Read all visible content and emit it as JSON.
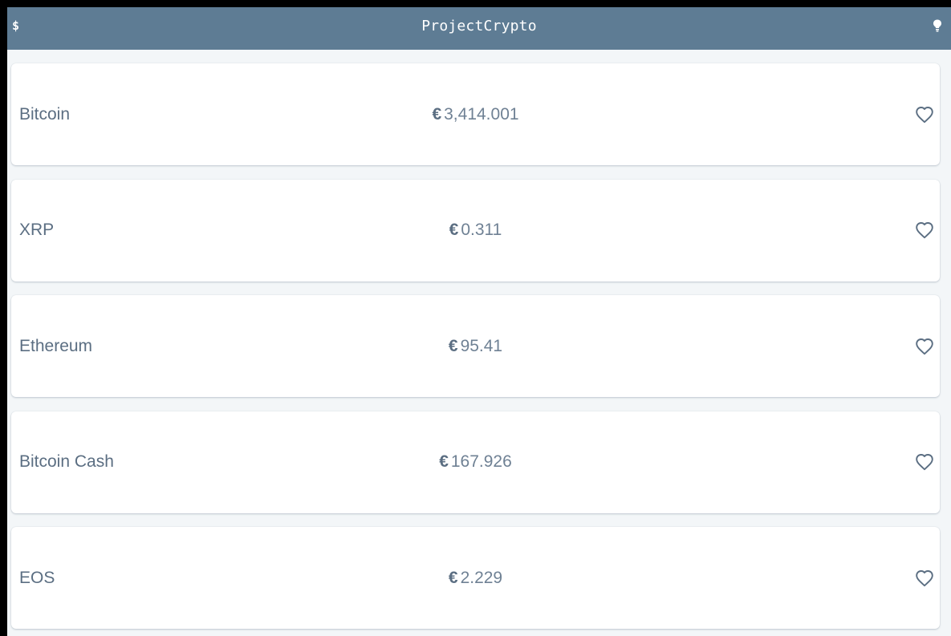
{
  "app": {
    "title": "ProjectCrypto",
    "left_icon_glyph": "$",
    "left_icon_name": "dollar-icon",
    "right_icon_name": "lightbulb-icon"
  },
  "colors": {
    "topbar": "#5e7c94",
    "background": "#f3f6f8",
    "text": "#5b6e82"
  },
  "coins": [
    {
      "name": "Bitcoin",
      "currency": "€",
      "price": "3,414.001",
      "favorite_icon": "heart-outline-icon"
    },
    {
      "name": "XRP",
      "currency": "€",
      "price": "0.311",
      "favorite_icon": "heart-outline-icon"
    },
    {
      "name": "Ethereum",
      "currency": "€",
      "price": "95.41",
      "favorite_icon": "heart-outline-icon"
    },
    {
      "name": "Bitcoin Cash",
      "currency": "€",
      "price": "167.926",
      "favorite_icon": "heart-outline-icon"
    },
    {
      "name": "EOS",
      "currency": "€",
      "price": "2.229",
      "favorite_icon": "heart-outline-icon"
    }
  ]
}
